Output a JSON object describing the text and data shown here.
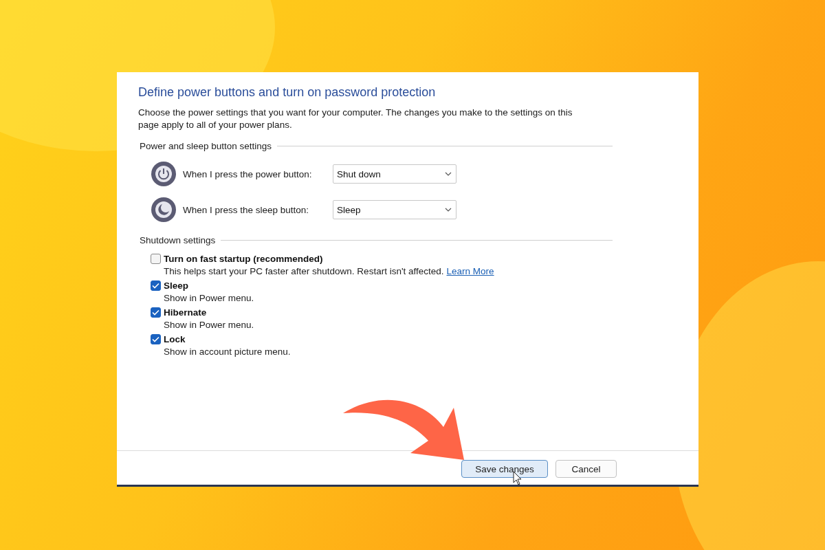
{
  "title": "Define power buttons and turn on password protection",
  "description": "Choose the power settings that you want for your computer. The changes you make to the settings on this page apply to all of your power plans.",
  "button_settings": {
    "heading": "Power and sleep button settings",
    "rows": [
      {
        "kind": "power",
        "label": "When I press the power button:",
        "value": "Shut down"
      },
      {
        "kind": "sleep",
        "label": "When I press the sleep button:",
        "value": "Sleep"
      }
    ]
  },
  "shutdown_settings": {
    "heading": "Shutdown settings",
    "options": [
      {
        "label": "Turn on fast startup (recommended)",
        "checked": false,
        "description": "This helps start your PC faster after shutdown. Restart isn't affected.",
        "link": "Learn More"
      },
      {
        "label": "Sleep",
        "checked": true,
        "description": "Show in Power menu."
      },
      {
        "label": "Hibernate",
        "checked": true,
        "description": "Show in Power menu."
      },
      {
        "label": "Lock",
        "checked": true,
        "description": "Show in account picture menu."
      }
    ]
  },
  "buttons": [
    {
      "label": "Save changes",
      "focused": true
    },
    {
      "label": "Cancel",
      "focused": false
    }
  ]
}
